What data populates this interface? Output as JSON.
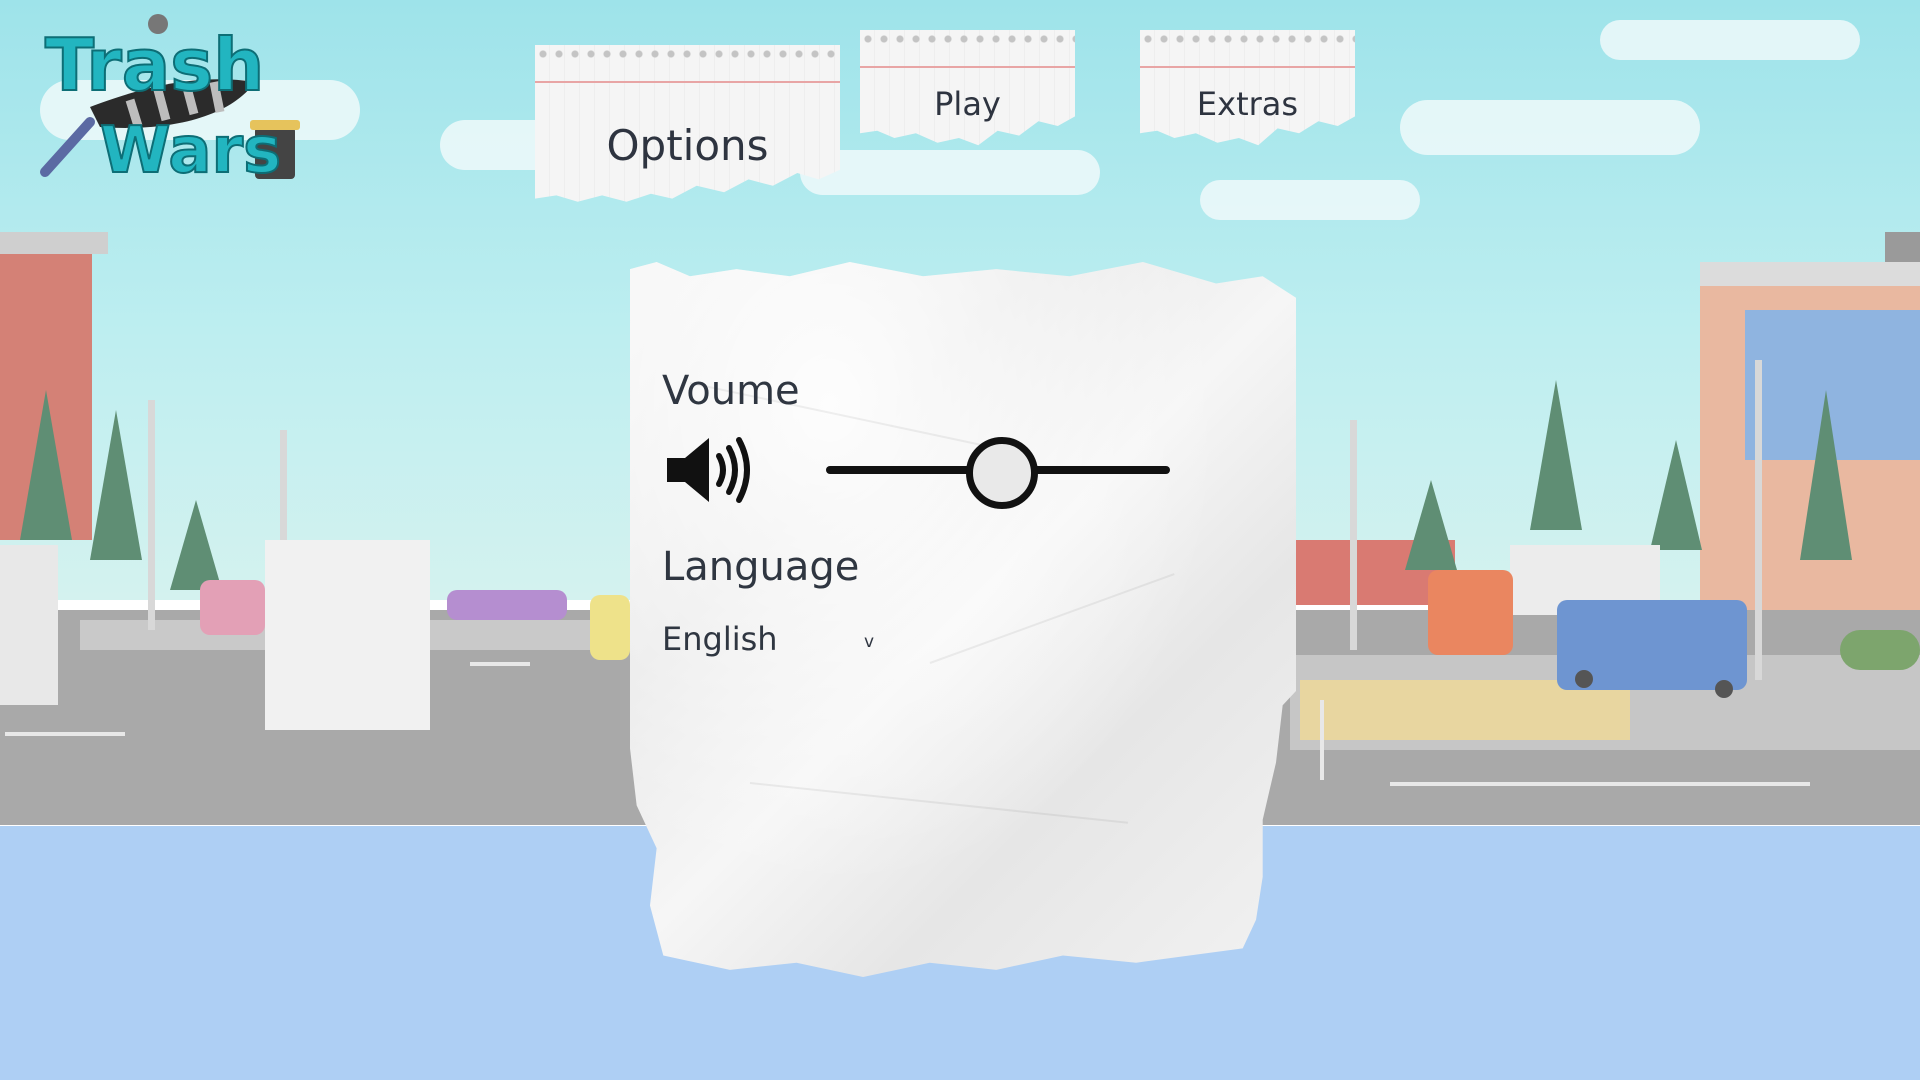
{
  "logo": {
    "line1": "Trash",
    "line2": "Wars"
  },
  "tabs": {
    "options": "Options",
    "play": "Play",
    "extras": "Extras"
  },
  "panel": {
    "volume_label": "Voume",
    "volume_level": 0.5,
    "language_label": "Language",
    "language_value": "English",
    "dropdown_arrow": "v"
  },
  "icons": {
    "speaker": "speaker-volume-icon"
  },
  "colors": {
    "sky": "#9ee3ea",
    "water": "#aecff4",
    "road": "#a9a9a9",
    "logo_teal": "#22b5c0",
    "text_dark": "#2f3641"
  }
}
